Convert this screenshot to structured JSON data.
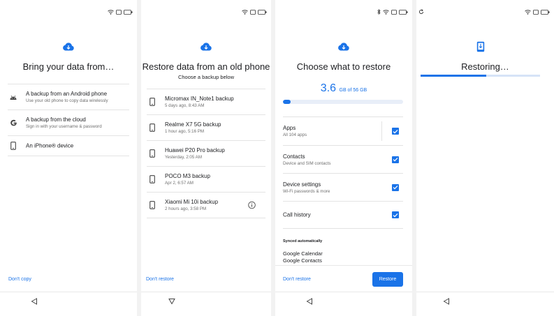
{
  "screen1": {
    "title": "Bring your data from…",
    "options": [
      {
        "label": "A backup from an Android phone",
        "sub": "Use your old phone to copy data wirelessly",
        "icon": "android-icon"
      },
      {
        "label": "A backup from the cloud",
        "sub": "Sign in with your username & password",
        "icon": "google-icon"
      },
      {
        "label": "An iPhone® device",
        "sub": "",
        "icon": "phone-icon"
      }
    ],
    "dont_copy": "Don't copy"
  },
  "screen2": {
    "title": "Restore data from an old phone",
    "subtitle": "Choose a backup below",
    "backups": [
      {
        "name": "Micromax IN_Note1 backup",
        "time": "5 days ago, 8:43 AM"
      },
      {
        "name": "Realme X7 5G backup",
        "time": "1 hour ago, 5:16 PM"
      },
      {
        "name": "Huawei P20 Pro backup",
        "time": "Yesterday, 2:05 AM"
      },
      {
        "name": "POCO M3 backup",
        "time": "Apr 2, 6:57 AM"
      },
      {
        "name": "Xiaomi Mi 10i backup",
        "time": "2 hours ago, 3:58 PM"
      }
    ],
    "dont_restore": "Don't restore"
  },
  "screen3": {
    "title": "Choose what to restore",
    "storage_value": "3.6",
    "storage_total": "GB of 56 GB",
    "storage_fraction": 0.064,
    "items": [
      {
        "label": "Apps",
        "sub": "All 104 apps",
        "checked": true
      },
      {
        "label": "Contacts",
        "sub": "Device and SIM contacts",
        "checked": true
      },
      {
        "label": "Device settings",
        "sub": "Wi-Fi passwords & more",
        "checked": true
      },
      {
        "label": "Call history",
        "sub": "",
        "checked": true
      }
    ],
    "synced_label": "Synced automatically",
    "synced_items": [
      "Google Calendar",
      "Google Contacts"
    ],
    "dont_restore": "Don't restore",
    "restore_button": "Restore"
  },
  "screen4": {
    "title": "Restoring…",
    "progress_fraction": 0.55
  },
  "colors": {
    "accent": "#1a73e8",
    "track": "#e8eef8"
  }
}
